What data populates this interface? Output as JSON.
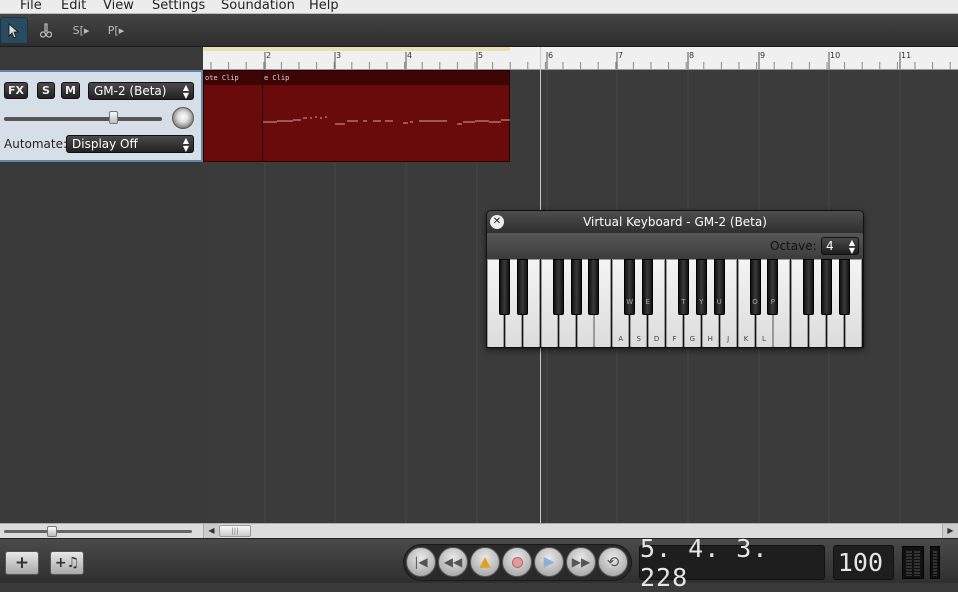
{
  "menu": {
    "items": [
      "File",
      "Edit",
      "View",
      "Settings",
      "Soundation",
      "Help"
    ]
  },
  "toolbar": {
    "tools": [
      "pointer-tool",
      "razor-tool",
      "s",
      "p"
    ],
    "s_label": "S",
    "p_label": "P"
  },
  "track": {
    "fx_label": "FX",
    "solo_label": "S",
    "mute_label": "M",
    "instrument": "GM-2 (Beta)",
    "volume_level": 0.7,
    "automate_label": "Automate:",
    "automate_value": "Display Off"
  },
  "ruler": {
    "marks": [
      "2",
      "3",
      "4",
      "5",
      "6",
      "7",
      "8",
      "9",
      "10",
      "11"
    ]
  },
  "clips": [
    {
      "title": "ote Clip"
    },
    {
      "title": "e Clip"
    }
  ],
  "virtual_keyboard": {
    "title": "Virtual Keyboard - GM-2 (Beta)",
    "octave_label": "Octave:",
    "octave_value": "4",
    "white_labels": [
      "",
      "",
      "",
      "",
      "",
      "",
      "",
      "A",
      "S",
      "D",
      "F",
      "G",
      "H",
      "J",
      "K",
      "L",
      "",
      "",
      "",
      "",
      ""
    ],
    "black_labels": [
      "",
      "",
      "",
      "",
      "",
      "W",
      "E",
      "T",
      "Y",
      "U",
      "O",
      "P",
      "",
      "",
      ""
    ]
  },
  "transport": {
    "position": "5. 4. 3. 228",
    "tempo": "100",
    "add_track_label": "+",
    "add_instrument_label": "+♫"
  },
  "colors": {
    "accent": "#5e87a6",
    "clip": "#6a0b0b",
    "metronome": "#e0a020"
  }
}
